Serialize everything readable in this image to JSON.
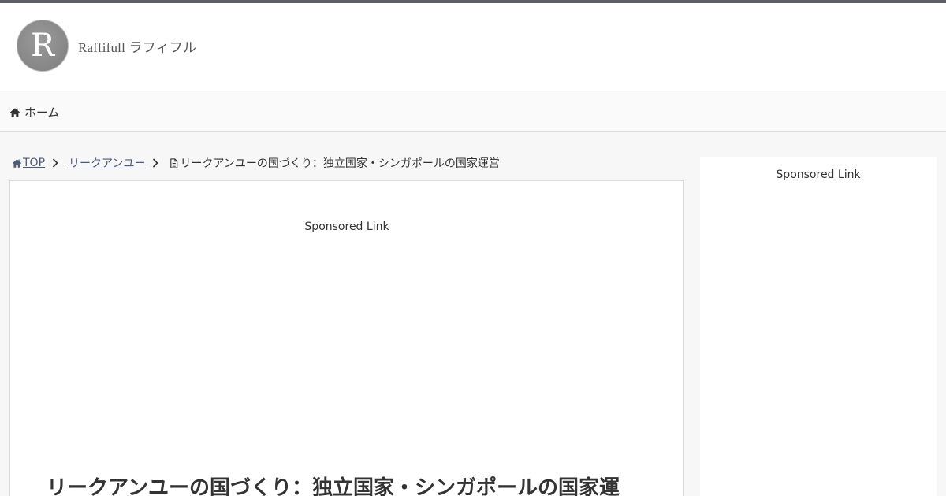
{
  "site": {
    "logo_letter": "R",
    "logo_text": "Raffifull ラフィフル"
  },
  "nav": {
    "home_label": "ホーム"
  },
  "breadcrumb": {
    "top_label": "TOP",
    "category_label": "リークアンユー",
    "current_label": "リークアンユーの国づくり：独立国家・シンガポールの国家運営"
  },
  "main": {
    "sponsored_label": "Sponsored Link",
    "title": "リークアンユーの国づくり：独立国家・シンガポールの国家運"
  },
  "sidebar": {
    "sponsored_label": "Sponsored Link"
  },
  "colors": {
    "topbar": "#5d5f66",
    "link": "#4c5a78",
    "text": "#333333",
    "background": "#f7f7f7"
  }
}
